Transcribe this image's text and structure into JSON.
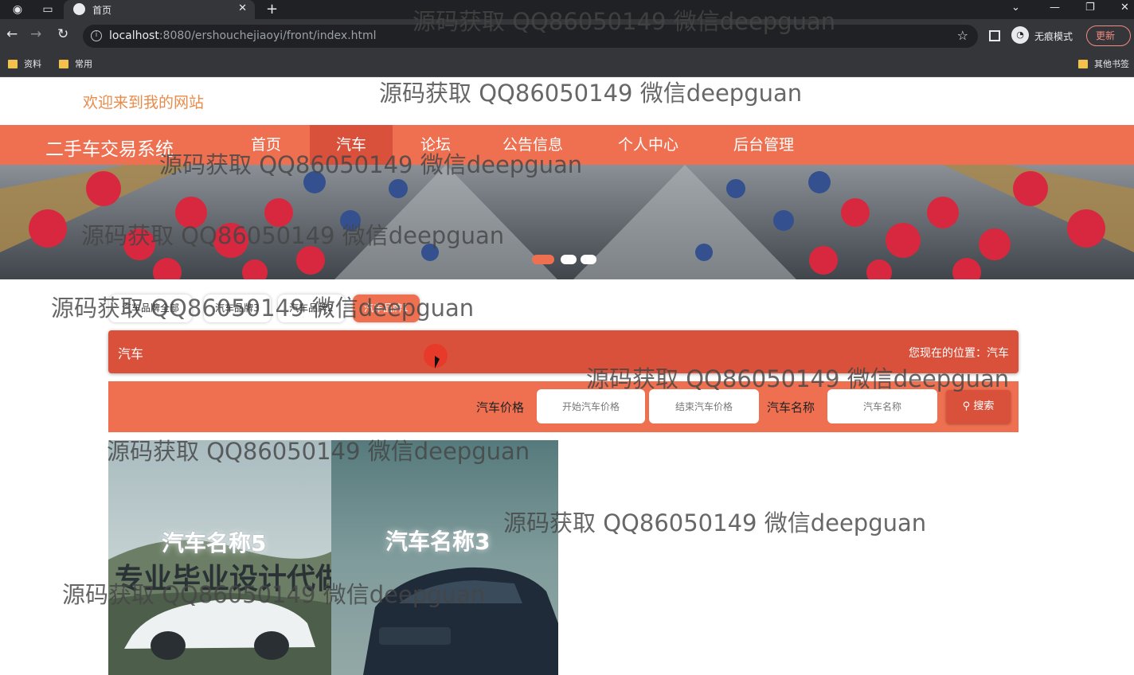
{
  "browser": {
    "tab_title": "首页",
    "tab_close": "✕",
    "new_tab": "+",
    "url_host": "localhost",
    "url_path": ":8080/ershouchejiaoyi/front/index.html",
    "incognito_label": "无痕模式",
    "update_label": "更新",
    "bookmarks": [
      "资料",
      "常用"
    ],
    "other_bookmarks": "其他书签"
  },
  "site": {
    "welcome": "欢迎来到我的网站",
    "brand": "二手车交易系统",
    "nav": [
      "首页",
      "汽车",
      "论坛",
      "公告信息",
      "个人中心",
      "后台管理"
    ],
    "active_nav": "汽车",
    "brand_tabs": [
      "汽车品牌全部",
      "汽车品牌3",
      "汽车品牌2",
      "汽车品牌1"
    ],
    "active_brand_tab": "汽车品牌1",
    "section_title": "汽车",
    "location_label": "您现在的位置：汽车",
    "search": {
      "price_label": "汽车价格",
      "price_start_placeholder": "开始汽车价格",
      "price_end_placeholder": "结束汽车价格",
      "name_label": "汽车名称",
      "name_placeholder": "汽车名称",
      "button_label": "搜索"
    },
    "cars": [
      {
        "name": "汽车名称5",
        "slogan": "专业毕业设计代做"
      },
      {
        "name": "汽车名称3"
      }
    ]
  },
  "banner_dots": {
    "count": 3,
    "active_index": 0
  },
  "watermark": "源码获取 QQ86050149 微信deepguan",
  "colors": {
    "primary": "#ef7050",
    "primary_dark": "#d9513a",
    "welcome": "#e98b4a"
  }
}
